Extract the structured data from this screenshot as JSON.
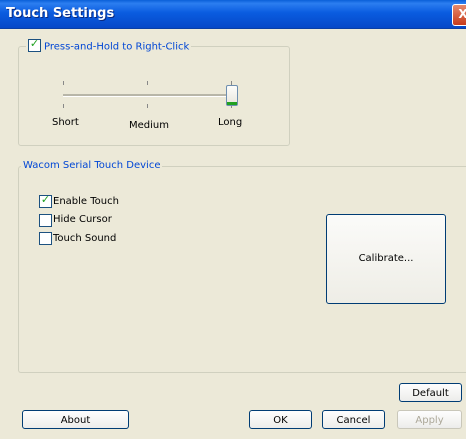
{
  "window": {
    "title": "Touch Settings",
    "close_glyph": "X"
  },
  "press_hold": {
    "label": "Press-and-Hold to Right-Click",
    "checked": true,
    "slider": {
      "labels": [
        "Short",
        "Medium",
        "Long"
      ],
      "value": "Long"
    }
  },
  "device": {
    "label": "Wacom Serial Touch Device",
    "options": [
      {
        "label": "Enable Touch",
        "checked": true
      },
      {
        "label": "Hide Cursor",
        "checked": false
      },
      {
        "label": "Touch Sound",
        "checked": false
      }
    ],
    "calibrate_label": "Calibrate..."
  },
  "buttons": {
    "default": "Default",
    "about": "About",
    "ok": "OK",
    "cancel": "Cancel",
    "apply": "Apply"
  }
}
